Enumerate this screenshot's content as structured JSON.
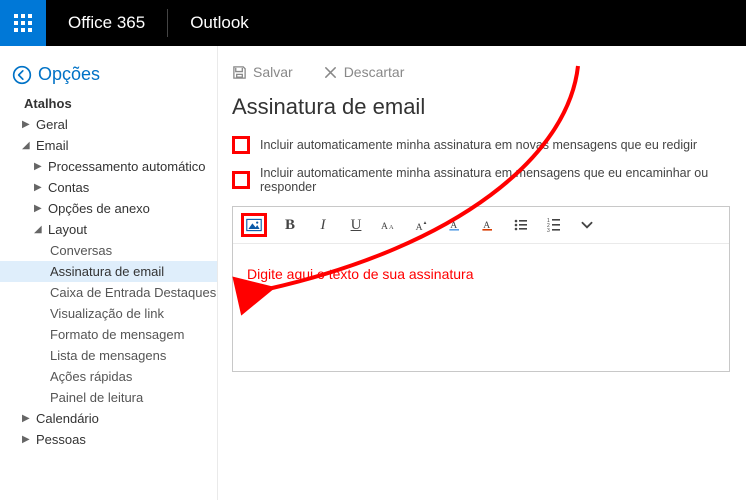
{
  "header": {
    "brand": "Office 365",
    "app": "Outlook"
  },
  "sidebar": {
    "back_label": "Opções",
    "atalhos": "Atalhos",
    "items": [
      {
        "label": "Geral",
        "expanded": false
      },
      {
        "label": "Email",
        "expanded": true,
        "children": [
          {
            "label": "Processamento automático",
            "expanded": false
          },
          {
            "label": "Contas",
            "expanded": false
          },
          {
            "label": "Opções de anexo",
            "expanded": false
          },
          {
            "label": "Layout",
            "expanded": true,
            "children": [
              {
                "label": "Conversas"
              },
              {
                "label": "Assinatura de email",
                "selected": true
              },
              {
                "label": "Caixa de Entrada Destaques"
              },
              {
                "label": "Visualização de link"
              },
              {
                "label": "Formato de mensagem"
              },
              {
                "label": "Lista de mensagens"
              },
              {
                "label": "Ações rápidas"
              },
              {
                "label": "Painel de leitura"
              }
            ]
          }
        ]
      },
      {
        "label": "Calendário",
        "expanded": false
      },
      {
        "label": "Pessoas",
        "expanded": false
      }
    ]
  },
  "main": {
    "save": "Salvar",
    "discard": "Descartar",
    "title": "Assinatura de email",
    "chk1": "Incluir automaticamente minha assinatura em novas mensagens que eu redigir",
    "chk2": "Incluir automaticamente minha assinatura em mensagens que eu encaminhar ou responder",
    "placeholder": "Digite aqui o texto de sua assinatura"
  }
}
